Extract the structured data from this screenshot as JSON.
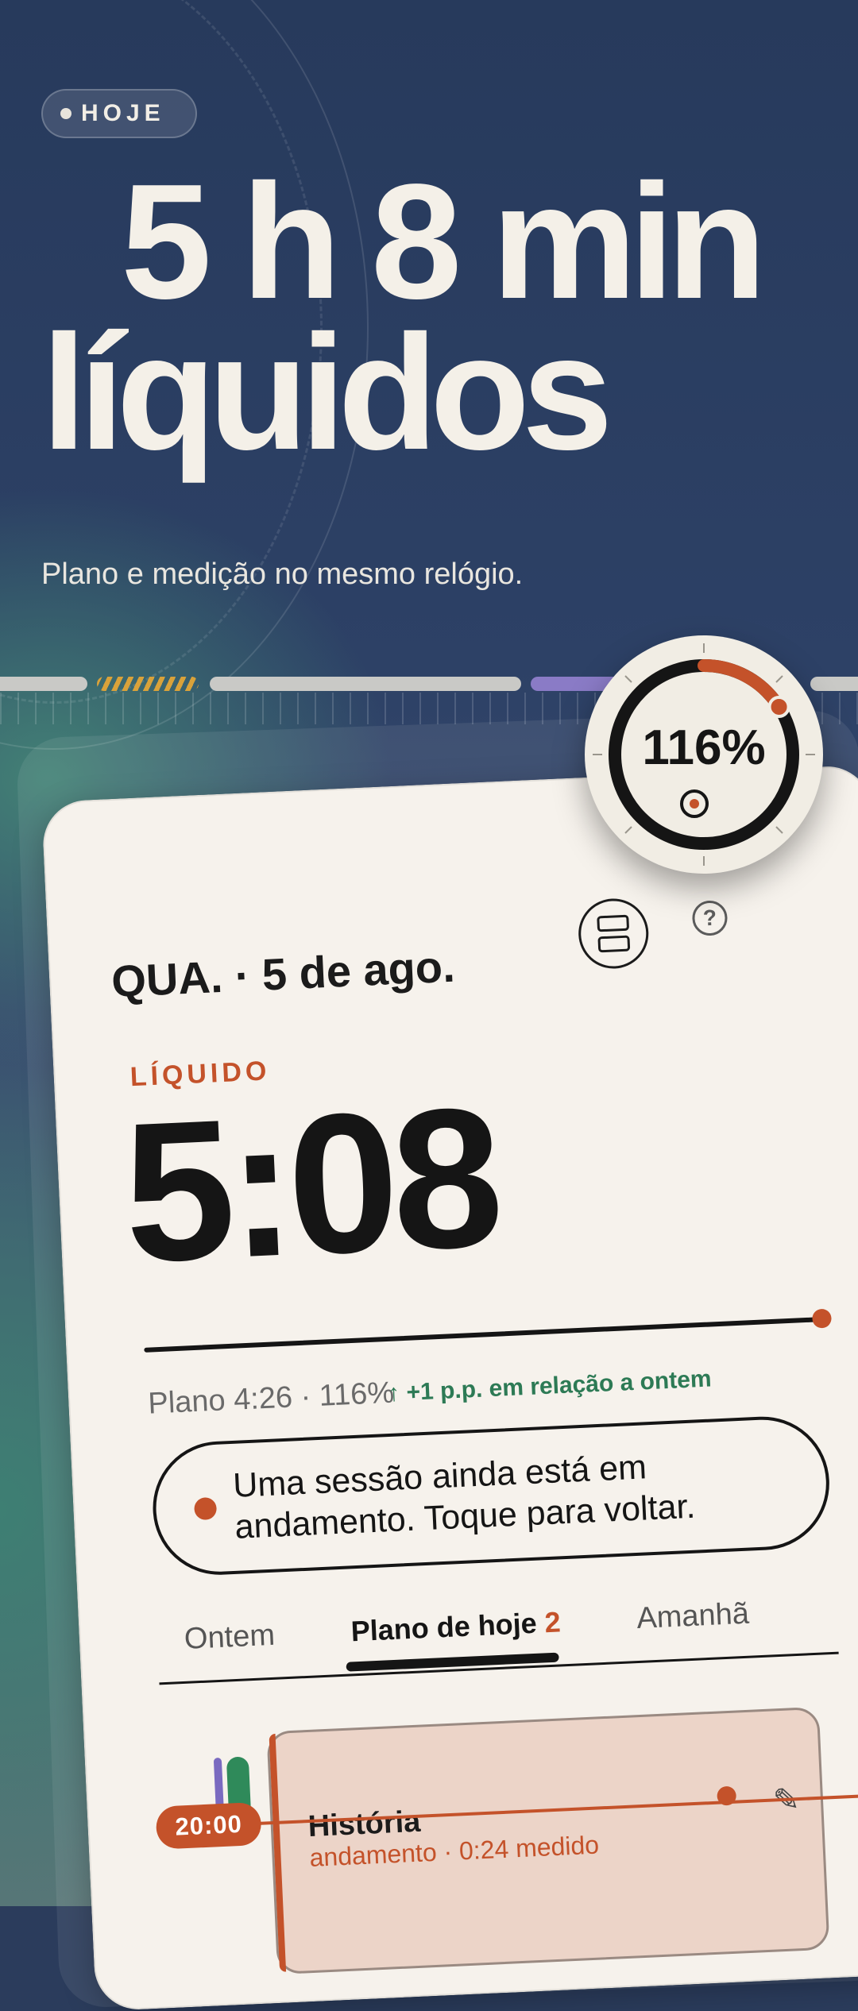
{
  "header": {
    "badge": "HOJE",
    "headline_line1": "5 h 8 min",
    "headline_line2": "líquidos",
    "subtitle": "Plano e medição no mesmo relógio."
  },
  "ring": {
    "percent_label": "116%",
    "progress_fraction": 0.16
  },
  "card": {
    "date": "QUA. · 5 de ago.",
    "help_icon": "?",
    "liquid_label": "LÍQUIDO",
    "liquid_time": "5:08",
    "plan_summary": "Plano 4:26 · 116%",
    "delta": "↑ +1 p.p. em relação a ontem",
    "session_message": "Uma sessão ainda está em andamento. Toque para voltar.",
    "tabs": [
      {
        "label": "Ontem"
      },
      {
        "label": "Plano de hoje",
        "count": "2"
      },
      {
        "label": "Amanhã"
      }
    ],
    "timeline": {
      "time_chip": "20:00",
      "event_title": "História",
      "event_subtitle": "andamento · 0:24 medido"
    }
  },
  "colors": {
    "accent": "#c4522a",
    "positive": "#2d7a55",
    "card_bg": "#f6f2ec",
    "event_bg": "#ecd4c8"
  },
  "icons": [
    "layers-icon",
    "help-icon",
    "edit-icon",
    "target-icon"
  ]
}
